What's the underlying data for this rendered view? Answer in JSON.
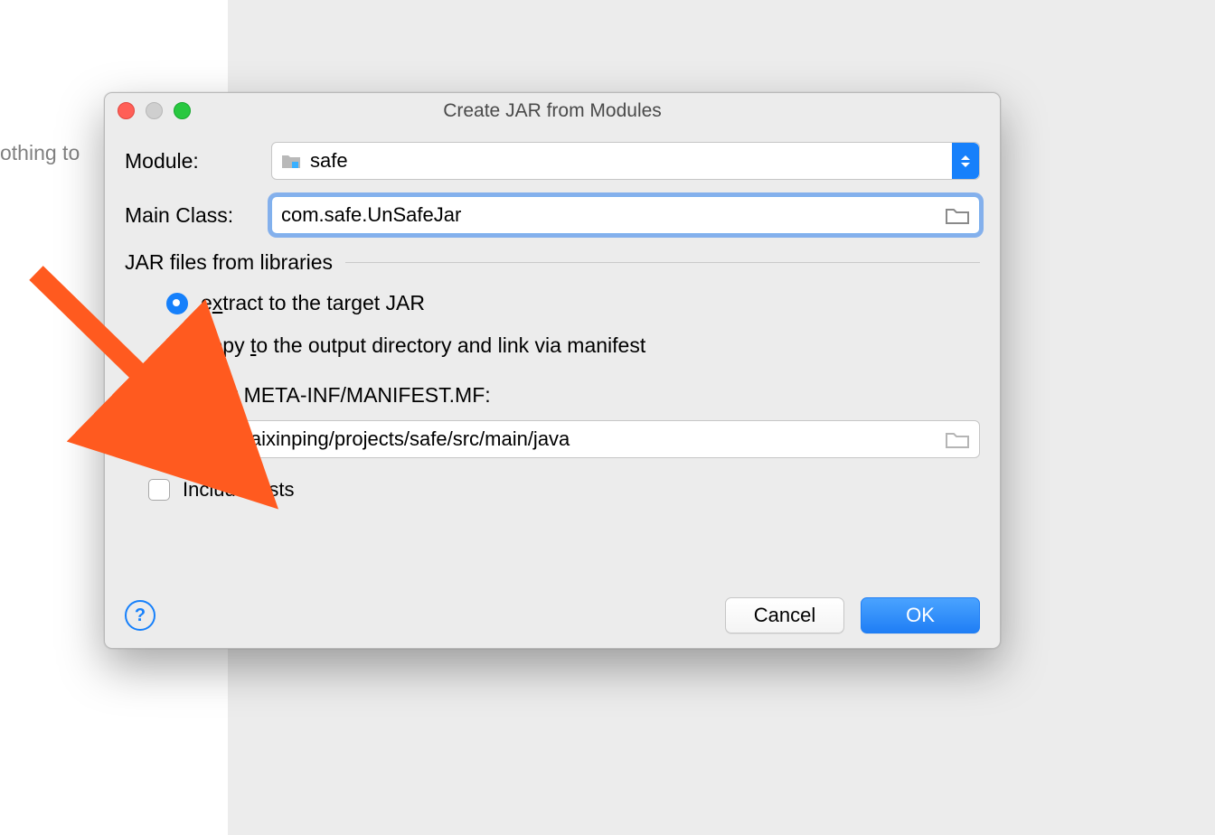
{
  "background_text": "othing to",
  "dialog": {
    "title": "Create JAR from Modules",
    "module": {
      "label": "Module:",
      "value": "safe"
    },
    "mainClass": {
      "label": "Main Class:",
      "value": "com.safe.UnSafeJar"
    },
    "fieldset_title": "JAR files from libraries",
    "radios": {
      "extract": {
        "pre": "e",
        "mn": "x",
        "post": "tract to the target JAR"
      },
      "copy": {
        "pre": "copy ",
        "mn": "t",
        "post": "o the output directory and link via manifest"
      }
    },
    "directory": {
      "label": "Directory for META-INF/MANIFEST.MF:",
      "value": "/Users/baixinping/projects/safe/src/main/java"
    },
    "include_tests": "Include tests",
    "help": "?",
    "cancel": "Cancel",
    "ok": "OK"
  }
}
